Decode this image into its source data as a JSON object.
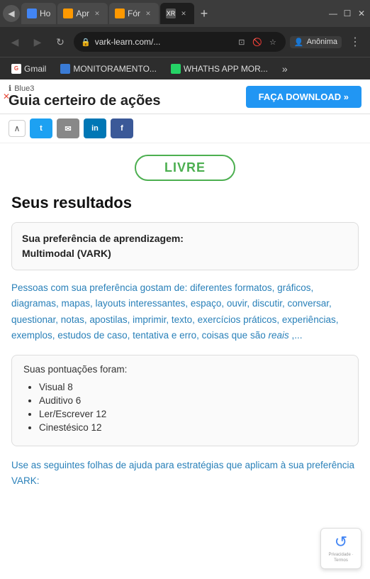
{
  "browser": {
    "tabs": [
      {
        "id": "home",
        "label": "Ho",
        "favicon_type": "generic",
        "active": false
      },
      {
        "id": "amazon1",
        "label": "Apr",
        "favicon_type": "amazon",
        "active": false
      },
      {
        "id": "amazon2",
        "label": "Fór",
        "favicon_type": "amazon2",
        "active": false
      },
      {
        "id": "vark",
        "label": "XR",
        "favicon_type": "vark",
        "active": true
      }
    ],
    "new_tab_label": "+",
    "window_buttons": [
      "—",
      "☐",
      "✕"
    ],
    "address": "vark-learn.com/...",
    "anon_label": "Anônima",
    "nav": {
      "back": "◀",
      "forward": "▶",
      "reload": "↻"
    },
    "bookmarks": [
      {
        "id": "gmail",
        "label": "Gmail",
        "type": "gmail"
      },
      {
        "id": "monitor",
        "label": "MONITORAMENTO...",
        "type": "monitor"
      },
      {
        "id": "whatsapp",
        "label": "WHATHS APP MOR...",
        "type": "whats"
      }
    ],
    "bookmarks_more": "»"
  },
  "banner": {
    "small_label": "Blue3",
    "title": "Guia certeiro de ações",
    "download_btn": "FAÇA DOWNLOAD »",
    "close_x": "✕",
    "info_icon": "ℹ"
  },
  "share_bar": {
    "toggle_icon": "^",
    "buttons": [
      {
        "id": "twitter",
        "label": "t",
        "type": "twitter"
      },
      {
        "id": "email",
        "label": "✉",
        "type": "email"
      },
      {
        "id": "linkedin",
        "label": "in",
        "type": "linkedin"
      },
      {
        "id": "facebook",
        "label": "f",
        "type": "facebook"
      }
    ]
  },
  "result": {
    "livre_label": "LIVRE",
    "title": "Seus resultados",
    "preference_box": {
      "label": "Sua preferência de aprendizagem:",
      "value": "Multimodal (VARK)"
    },
    "description": "Pessoas com sua preferência gostam de: diferentes formatos, gráficos, diagramas, mapas, layouts interessantes, espaço, ouvir, discutir, conversar, questionar, notas, apostilas, imprimir, texto, exercícios práticos, experiências, exemplos, estudos de caso, tentativa e erro, coisas que são ",
    "description_italic": "reais",
    "description_end": " ,...",
    "scores_box": {
      "title": "Suas pontuações foram:",
      "items": [
        "Visual 8",
        "Auditivo 6",
        "Ler/Escrever 12",
        "Cinestésico 12"
      ]
    },
    "help_text": "Use as seguintes folhas de ajuda para estratégias que aplicam à sua preferência VARK:"
  },
  "recaptcha": {
    "icon": "↺",
    "label": "Privacidade · Termos"
  }
}
